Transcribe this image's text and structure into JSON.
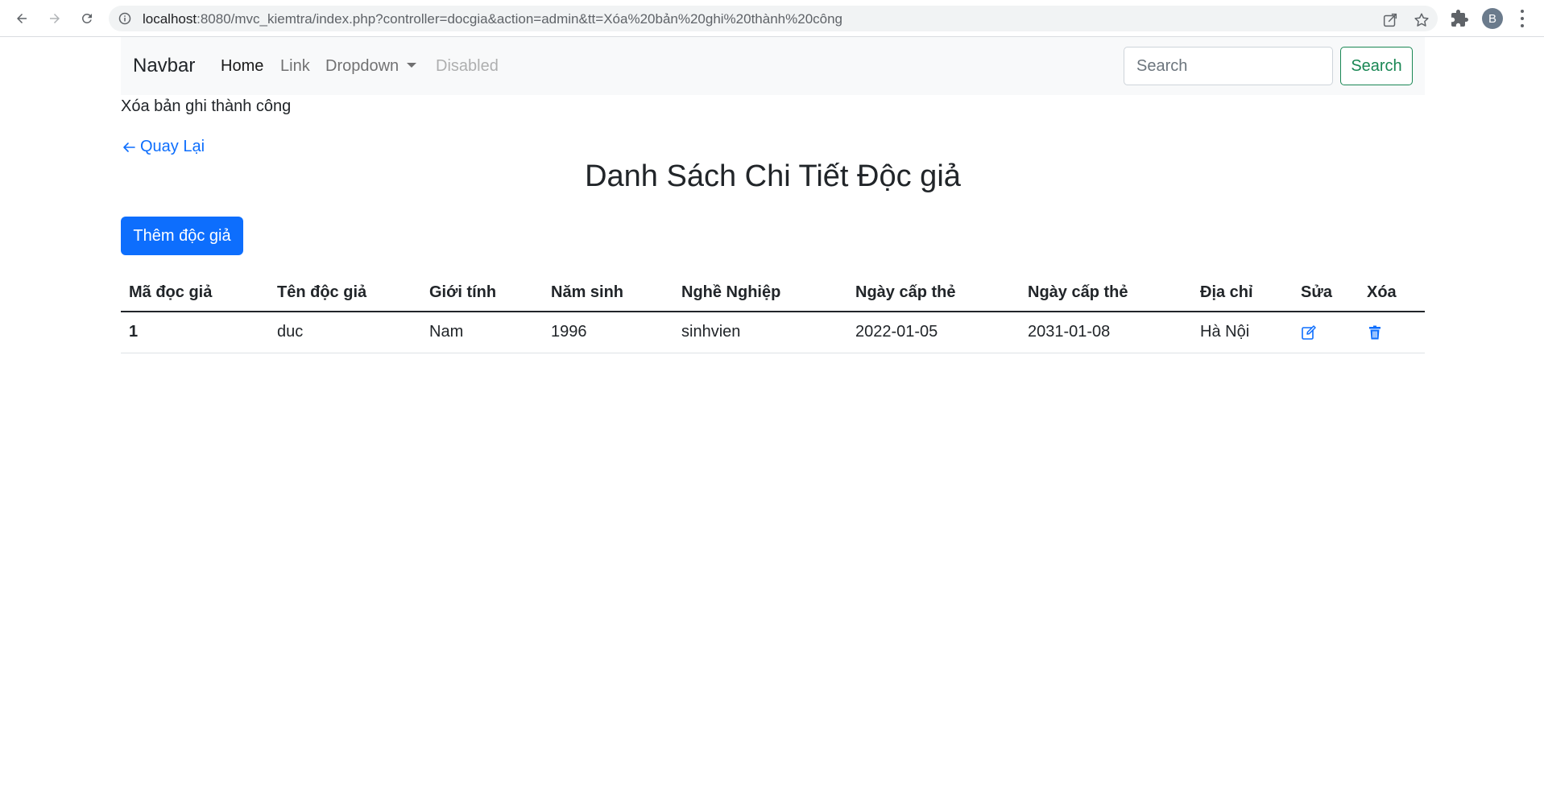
{
  "browser": {
    "url_host": "localhost",
    "url_rest": ":8080/mvc_kiemtra/index.php?controller=docgia&action=admin&tt=Xóa%20bản%20ghi%20thành%20công",
    "avatar_letter": "B"
  },
  "navbar": {
    "brand": "Navbar",
    "links": [
      "Home",
      "Link",
      "Dropdown",
      "Disabled"
    ],
    "search_placeholder": "Search",
    "search_button": "Search"
  },
  "flash_message": "Xóa bản ghi thành công",
  "back_link": "Quay Lại",
  "page_title": "Danh Sách Chi Tiết Độc giả",
  "add_button": "Thêm độc giả",
  "table": {
    "headers": [
      "Mã đọc giả",
      "Tên độc giả",
      "Giới tính",
      "Năm sinh",
      "Nghề Nghiệp",
      "Ngày cấp thẻ",
      "Ngày cấp thẻ",
      "Địa chỉ",
      "Sửa",
      "Xóa"
    ],
    "rows": [
      {
        "id": "1",
        "name": "duc",
        "gender": "Nam",
        "birth_year": "1996",
        "job": "sinhvien",
        "issue_date": "2022-01-05",
        "expiry_date": "2031-01-08",
        "address": "Hà Nội",
        "edit_icon": "edit-icon",
        "delete_icon": "trash-icon"
      }
    ]
  },
  "colors": {
    "primary": "#0d6efd",
    "success": "#198754",
    "navbar_bg": "#f8f9fa"
  }
}
